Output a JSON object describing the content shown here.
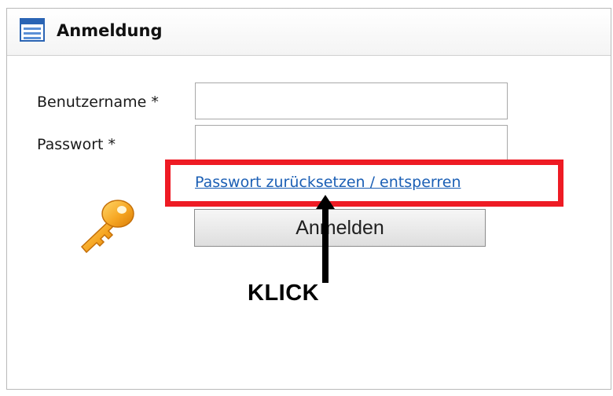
{
  "dialog": {
    "title": "Anmeldung",
    "title_icon": "window-form-icon"
  },
  "form": {
    "username_label": "Benutzername *",
    "username_value": "",
    "password_label": "Passwort *",
    "password_value": "",
    "reset_link": "Passwort zurücksetzen / entsperren",
    "login_button": "Anmelden",
    "key_icon": "key-icon"
  },
  "annotation": {
    "callout_text": "KLICK",
    "highlight_color": "#ee1b24",
    "arrow_icon": "arrow-up-icon"
  },
  "colors": {
    "link": "#1b5fb5",
    "highlight": "#ee1b24"
  }
}
